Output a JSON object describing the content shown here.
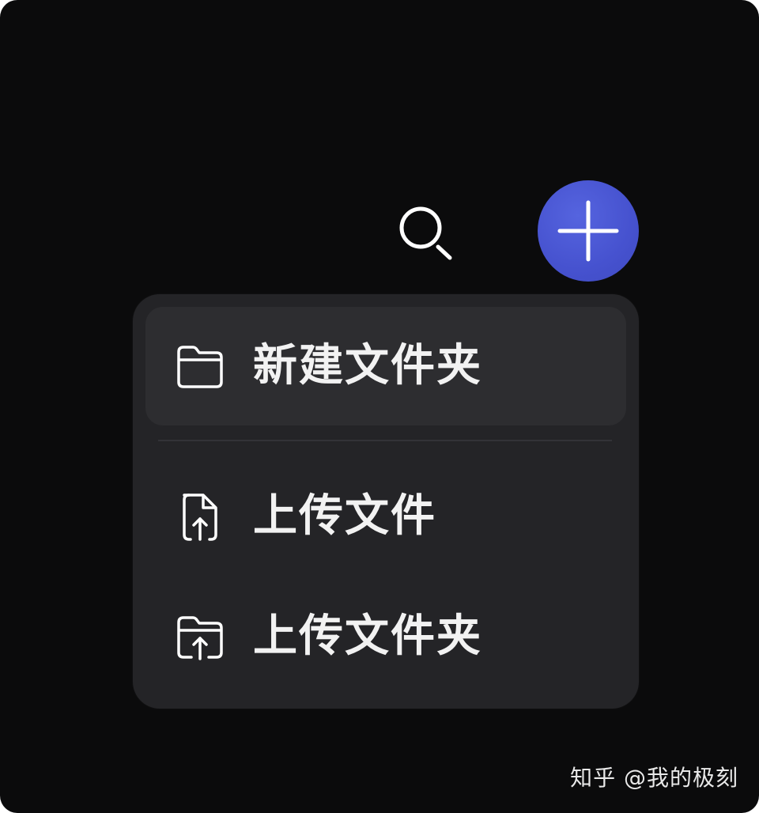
{
  "toolbar": {
    "search_icon": "search-icon",
    "add_icon": "plus-icon",
    "accent_color": "#4652cf"
  },
  "menu": {
    "background_color": "#242427",
    "items": [
      {
        "label": "新建文件夹",
        "icon": "folder-icon"
      },
      {
        "label": "上传文件",
        "icon": "file-upload-icon"
      },
      {
        "label": "上传文件夹",
        "icon": "folder-upload-icon"
      }
    ]
  },
  "watermark": {
    "text": "知乎 @我的极刻"
  }
}
